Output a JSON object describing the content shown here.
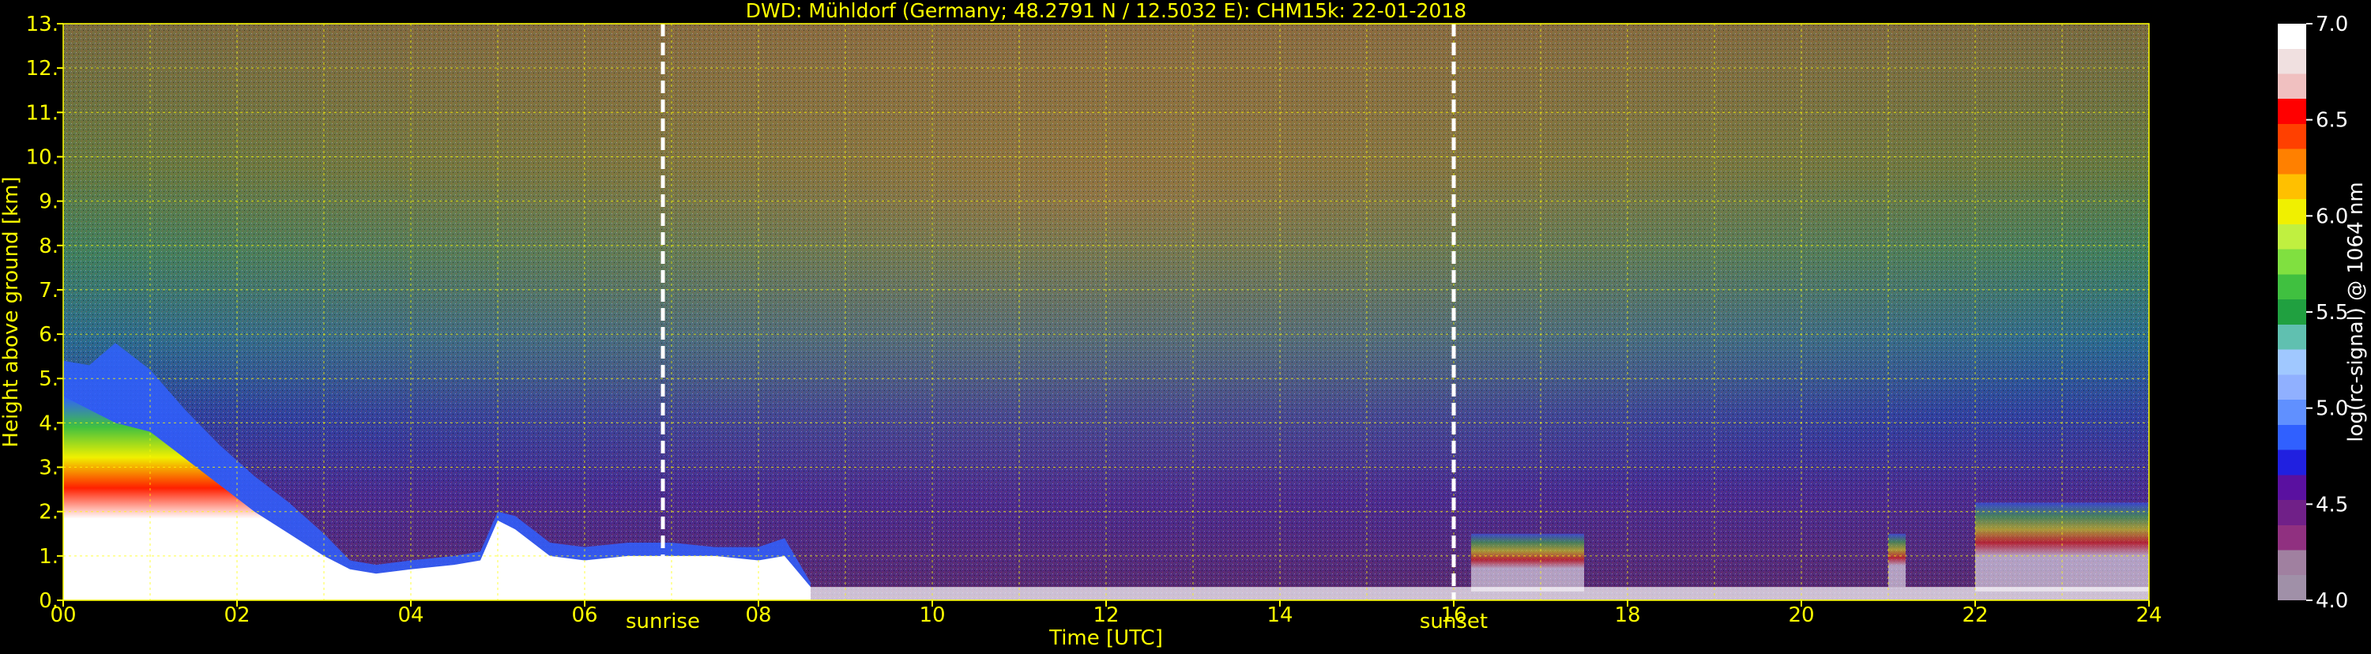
{
  "chart_data": {
    "type": "heatmap",
    "title": "DWD: Mühldorf (Germany; 48.2791 N / 12.5032 E):    CHM15k: 22-01-2018",
    "xlabel": "Time [UTC]",
    "ylabel": "Height above ground [km]",
    "xlim": [
      0,
      24
    ],
    "ylim": [
      0,
      13
    ],
    "x_ticks": [
      "00",
      "02",
      "04",
      "06",
      "08",
      "10",
      "12",
      "14",
      "16",
      "18",
      "20",
      "22",
      "24"
    ],
    "y_ticks": [
      "0.",
      "1.",
      "2.",
      "3.",
      "4.",
      "5.",
      "6.",
      "7.",
      "8.",
      "9.",
      "10.",
      "11.",
      "12.",
      "13."
    ],
    "grid": true,
    "events": [
      {
        "label": "sunrise",
        "time": 6.9
      },
      {
        "label": "sunset",
        "time": 16.0
      }
    ],
    "colorbar": {
      "label": "log(rc-signal) @ 1064 nm",
      "range": [
        4.0,
        7.0
      ],
      "ticks": [
        "4.0",
        "4.5",
        "5.0",
        "5.5",
        "6.0",
        "6.5",
        "7.0"
      ],
      "colors": [
        "#a090a8",
        "#a080a0",
        "#903080",
        "#702088",
        "#5a10a0",
        "#2020e0",
        "#3060ff",
        "#6090ff",
        "#90b0ff",
        "#a0c8ff",
        "#60c0b0",
        "#20a040",
        "#40c040",
        "#80e040",
        "#c0f040",
        "#f0f000",
        "#ffc000",
        "#ff8000",
        "#ff4000",
        "#ff0000",
        "#f0c0c0",
        "#f0e0e0",
        "#ffffff"
      ]
    },
    "features": {
      "boundary_layer_top_km": {
        "time": [
          0,
          0.3,
          0.6,
          1.0,
          1.4,
          1.8,
          2.2,
          2.6,
          3.0,
          3.3,
          3.6,
          4.0,
          4.5,
          4.8,
          5.0,
          5.2,
          5.6,
          6.0,
          6.5,
          7.0,
          7.5,
          8.0,
          8.3,
          8.6
        ],
        "height": [
          4.6,
          4.3,
          4.0,
          3.8,
          3.2,
          2.6,
          2.0,
          1.5,
          1.0,
          0.7,
          0.6,
          0.7,
          0.8,
          0.9,
          1.8,
          1.6,
          1.0,
          0.9,
          1.0,
          1.0,
          1.0,
          0.9,
          1.0,
          0.3
        ]
      },
      "high_signal_band_top_km": {
        "time": [
          0,
          0.3,
          0.6,
          1.0,
          1.4,
          1.8,
          2.2,
          2.6,
          3.0,
          3.3,
          3.6,
          4.0,
          4.5,
          4.8,
          5.0,
          5.2,
          5.6,
          6.0,
          6.5,
          7.0,
          7.5,
          8.0,
          8.3,
          8.6
        ],
        "height": [
          5.4,
          5.3,
          5.8,
          5.2,
          4.3,
          3.5,
          2.8,
          2.2,
          1.5,
          0.9,
          0.8,
          0.9,
          1.0,
          1.1,
          2.0,
          1.9,
          1.3,
          1.2,
          1.3,
          1.3,
          1.2,
          1.2,
          1.4,
          0.4
        ]
      },
      "evening_layers_km": [
        {
          "time": [
            16.2,
            17.5
          ],
          "height": [
            0.2,
            1.5
          ]
        },
        {
          "time": [
            21.0,
            21.2
          ],
          "height": [
            0.3,
            1.5
          ]
        },
        {
          "time": [
            22.0,
            24.0
          ],
          "height": [
            0.2,
            2.2
          ]
        }
      ]
    }
  }
}
